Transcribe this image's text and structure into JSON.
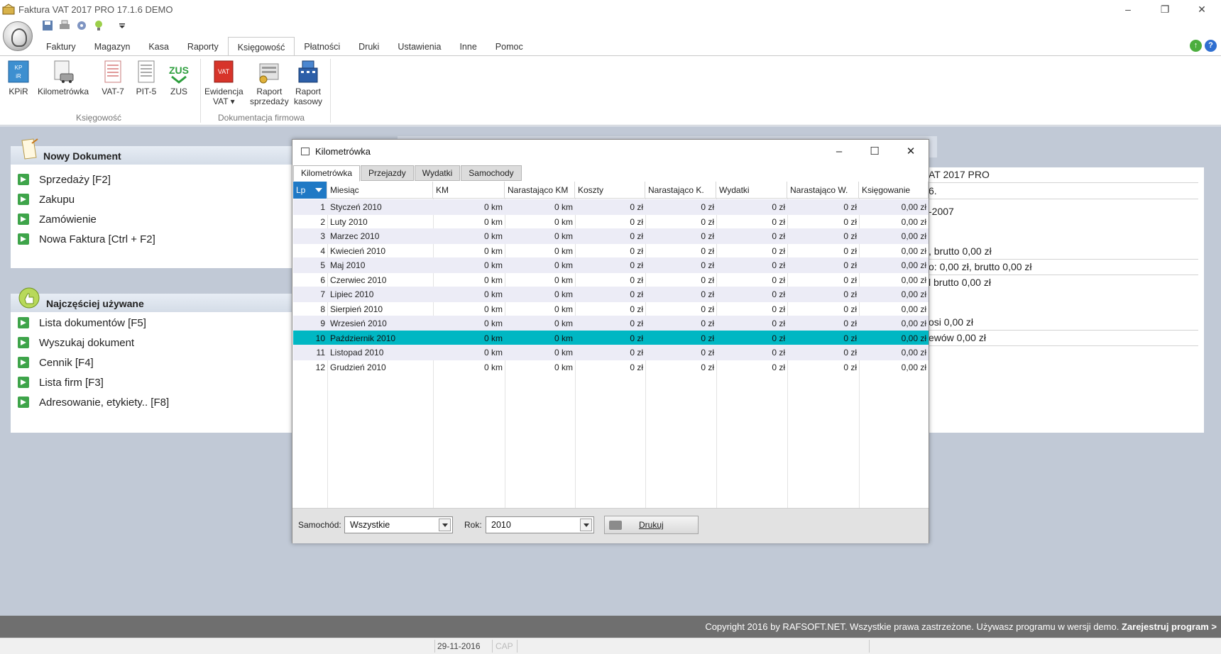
{
  "window": {
    "title": "Faktura VAT 2017 PRO 17.1.6 DEMO",
    "controls": [
      "–",
      "❐",
      "✕"
    ]
  },
  "ribbon": {
    "tabs": [
      "Faktury",
      "Magazyn",
      "Kasa",
      "Raporty",
      "Księgowość",
      "Płatności",
      "Druki",
      "Ustawienia",
      "Inne",
      "Pomoc"
    ],
    "active_tab": "Księgowość",
    "groups": [
      {
        "label": "Księgowość",
        "buttons": [
          {
            "label": "KPiR",
            "icon": "kpir-icon"
          },
          {
            "label": "Kilometrówka",
            "icon": "car-document-icon"
          },
          {
            "label": "VAT-7",
            "icon": "vat7-form-icon"
          },
          {
            "label": "PIT-5",
            "icon": "pit5-form-icon"
          },
          {
            "label": "ZUS",
            "icon": "zus-icon"
          }
        ]
      },
      {
        "label": "Dokumentacja firmowa",
        "buttons": [
          {
            "label": "Ewidencja",
            "label2": "VAT ▾",
            "icon": "vat-register-icon"
          },
          {
            "label": "Raport",
            "label2": "sprzedaży",
            "icon": "sales-report-icon"
          },
          {
            "label": "Raport",
            "label2": "kasowy",
            "icon": "cash-register-icon"
          }
        ]
      }
    ]
  },
  "panels": {
    "new_document": {
      "title": "Nowy Dokument",
      "links": [
        "Sprzedaży [F2]",
        "Zakupu",
        "Zamówienie",
        "Nowa Faktura [Ctrl + F2]"
      ]
    },
    "most_used": {
      "title": "Najczęściej używane",
      "links": [
        "Lista dokumentów [F5]",
        "Wyszukaj dokument",
        "Cennik [F4]",
        "Lista firm [F3]",
        "Adresowanie, etykiety.. [F8]"
      ]
    },
    "info_lines": [
      "AT 2017 PRO",
      "6.",
      "-2007",
      ", brutto 0,00 zł",
      "o: 0,00 zł, brutto 0,00 zł",
      "l brutto 0,00 zł",
      "osi 0,00 zł",
      "ewów 0,00 zł"
    ]
  },
  "dialog": {
    "title": "Kilometrówka",
    "tabs": [
      "Kilometrówka",
      "Przejazdy",
      "Wydatki",
      "Samochody"
    ],
    "active_tab": "Kilometrówka",
    "columns": [
      "Lp",
      "Miesiąc",
      "KM",
      "Narastająco KM",
      "Koszty",
      "Narastająco K.",
      "Wydatki",
      "Narastająco W.",
      "Księgowanie"
    ],
    "rows": [
      {
        "lp": "1",
        "miesiac": "Styczeń 2010",
        "km": "0 km",
        "nar_km": "0 km",
        "koszty": "0 zł",
        "nar_k": "0 zł",
        "wydatki": "0 zł",
        "nar_w": "0 zł",
        "ksieg": "0,00 zł"
      },
      {
        "lp": "2",
        "miesiac": "Luty 2010",
        "km": "0 km",
        "nar_km": "0 km",
        "koszty": "0 zł",
        "nar_k": "0 zł",
        "wydatki": "0 zł",
        "nar_w": "0 zł",
        "ksieg": "0,00 zł"
      },
      {
        "lp": "3",
        "miesiac": "Marzec 2010",
        "km": "0 km",
        "nar_km": "0 km",
        "koszty": "0 zł",
        "nar_k": "0 zł",
        "wydatki": "0 zł",
        "nar_w": "0 zł",
        "ksieg": "0,00 zł"
      },
      {
        "lp": "4",
        "miesiac": "Kwiecień 2010",
        "km": "0 km",
        "nar_km": "0 km",
        "koszty": "0 zł",
        "nar_k": "0 zł",
        "wydatki": "0 zł",
        "nar_w": "0 zł",
        "ksieg": "0,00 zł"
      },
      {
        "lp": "5",
        "miesiac": "Maj 2010",
        "km": "0 km",
        "nar_km": "0 km",
        "koszty": "0 zł",
        "nar_k": "0 zł",
        "wydatki": "0 zł",
        "nar_w": "0 zł",
        "ksieg": "0,00 zł"
      },
      {
        "lp": "6",
        "miesiac": "Czerwiec 2010",
        "km": "0 km",
        "nar_km": "0 km",
        "koszty": "0 zł",
        "nar_k": "0 zł",
        "wydatki": "0 zł",
        "nar_w": "0 zł",
        "ksieg": "0,00 zł"
      },
      {
        "lp": "7",
        "miesiac": "Lipiec 2010",
        "km": "0 km",
        "nar_km": "0 km",
        "koszty": "0 zł",
        "nar_k": "0 zł",
        "wydatki": "0 zł",
        "nar_w": "0 zł",
        "ksieg": "0,00 zł"
      },
      {
        "lp": "8",
        "miesiac": "Sierpień 2010",
        "km": "0 km",
        "nar_km": "0 km",
        "koszty": "0 zł",
        "nar_k": "0 zł",
        "wydatki": "0 zł",
        "nar_w": "0 zł",
        "ksieg": "0,00 zł"
      },
      {
        "lp": "9",
        "miesiac": "Wrzesień 2010",
        "km": "0 km",
        "nar_km": "0 km",
        "koszty": "0 zł",
        "nar_k": "0 zł",
        "wydatki": "0 zł",
        "nar_w": "0 zł",
        "ksieg": "0,00 zł"
      },
      {
        "lp": "10",
        "miesiac": "Październik 2010",
        "km": "0 km",
        "nar_km": "0 km",
        "koszty": "0 zł",
        "nar_k": "0 zł",
        "wydatki": "0 zł",
        "nar_w": "0 zł",
        "ksieg": "0,00 zł"
      },
      {
        "lp": "11",
        "miesiac": "Listopad 2010",
        "km": "0 km",
        "nar_km": "0 km",
        "koszty": "0 zł",
        "nar_k": "0 zł",
        "wydatki": "0 zł",
        "nar_w": "0 zł",
        "ksieg": "0,00 zł"
      },
      {
        "lp": "12",
        "miesiac": "Grudzień 2010",
        "km": "0 km",
        "nar_km": "0 km",
        "koszty": "0 zł",
        "nar_k": "0 zł",
        "wydatki": "0 zł",
        "nar_w": "0 zł",
        "ksieg": "0,00 zł"
      }
    ],
    "selected_row": 10,
    "bottom": {
      "car_label": "Samochód:",
      "car_value": "Wszystkie",
      "year_label": "Rok:",
      "year_value": "2010",
      "print_label": "Drukuj"
    }
  },
  "footer": {
    "copyright": "Copyright 2016 by RAFSOFT.NET. Wszystkie prawa zastrzeżone. Używasz programu w wersji demo.",
    "register_link": "Zarejestruj program >"
  },
  "status": {
    "date": "29-11-2016",
    "cap": "CAP"
  },
  "colors": {
    "selection": "#00b7c3",
    "sort_header": "#1f79c5",
    "workspace": "#c1c9d6",
    "link_arrow": "#3ea44a",
    "footer": "#6f6f6f"
  }
}
